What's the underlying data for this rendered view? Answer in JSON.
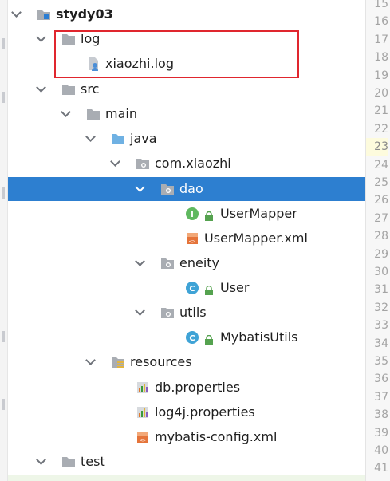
{
  "tree": {
    "items": [
      {
        "label": "stydy03",
        "icon": "module-folder-icon",
        "bold": true
      },
      {
        "label": "log",
        "icon": "folder-icon"
      },
      {
        "label": "xiaozhi.log",
        "icon": "log-file-icon"
      },
      {
        "label": "src",
        "icon": "folder-icon"
      },
      {
        "label": "main",
        "icon": "folder-icon"
      },
      {
        "label": "java",
        "icon": "source-folder-icon"
      },
      {
        "label": "com.xiaozhi",
        "icon": "package-icon"
      },
      {
        "label": "dao",
        "icon": "package-icon"
      },
      {
        "label": "UserMapper",
        "icon": "interface-icon"
      },
      {
        "label": "UserMapper.xml",
        "icon": "xml-file-icon"
      },
      {
        "label": "eneity",
        "icon": "package-icon"
      },
      {
        "label": "User",
        "icon": "class-icon"
      },
      {
        "label": "utils",
        "icon": "package-icon"
      },
      {
        "label": "MybatisUtils",
        "icon": "class-icon"
      },
      {
        "label": "resources",
        "icon": "resources-folder-icon"
      },
      {
        "label": "db.properties",
        "icon": "properties-file-icon"
      },
      {
        "label": "log4j.properties",
        "icon": "properties-file-icon"
      },
      {
        "label": "mybatis-config.xml",
        "icon": "xml-file-icon"
      },
      {
        "label": "test",
        "icon": "folder-icon"
      }
    ]
  },
  "gutter": {
    "line_numbers": [
      "15",
      "16",
      "17",
      "18",
      "19",
      "20",
      "21",
      "22",
      "23",
      "24",
      "25",
      "26",
      "27",
      "28",
      "29",
      "30",
      "31",
      "32",
      "33",
      "34",
      "35",
      "36",
      "37",
      "38",
      "39",
      "40",
      "41"
    ],
    "current_line": "23"
  },
  "colors": {
    "selection": "#2d7fd0",
    "highlight_box": "#e0262e",
    "folder": "#a9adb3",
    "source_folder": "#6fb1e3",
    "interface": "#5fb85f",
    "class": "#3fa3d6",
    "xml": "#e5743a"
  }
}
